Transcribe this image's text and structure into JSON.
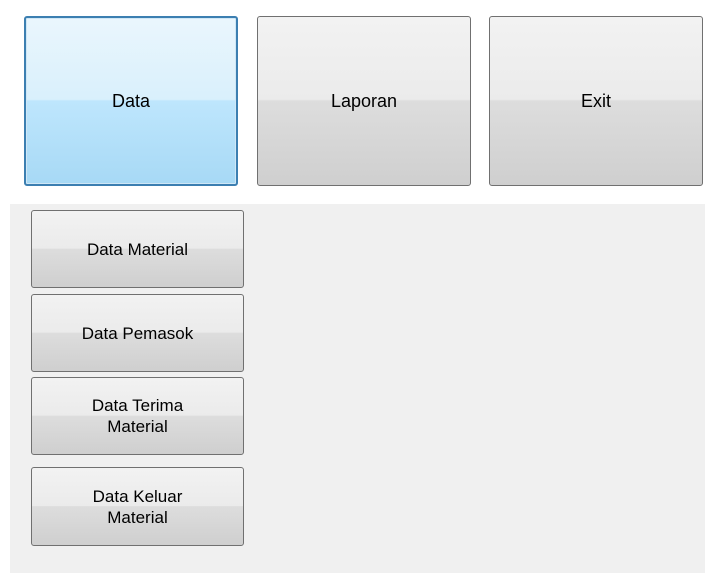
{
  "menu": {
    "data_label": "Data",
    "laporan_label": "Laporan",
    "exit_label": "Exit"
  },
  "submenu": {
    "items": [
      {
        "label": "Data Material"
      },
      {
        "label": "Data Pemasok"
      },
      {
        "label": "Data Terima\nMaterial"
      },
      {
        "label": "Data Keluar\nMaterial"
      }
    ]
  },
  "colors": {
    "form_background": "#f0f0f0",
    "focus_border": "#3c7fb1",
    "button_border": "#707070"
  }
}
